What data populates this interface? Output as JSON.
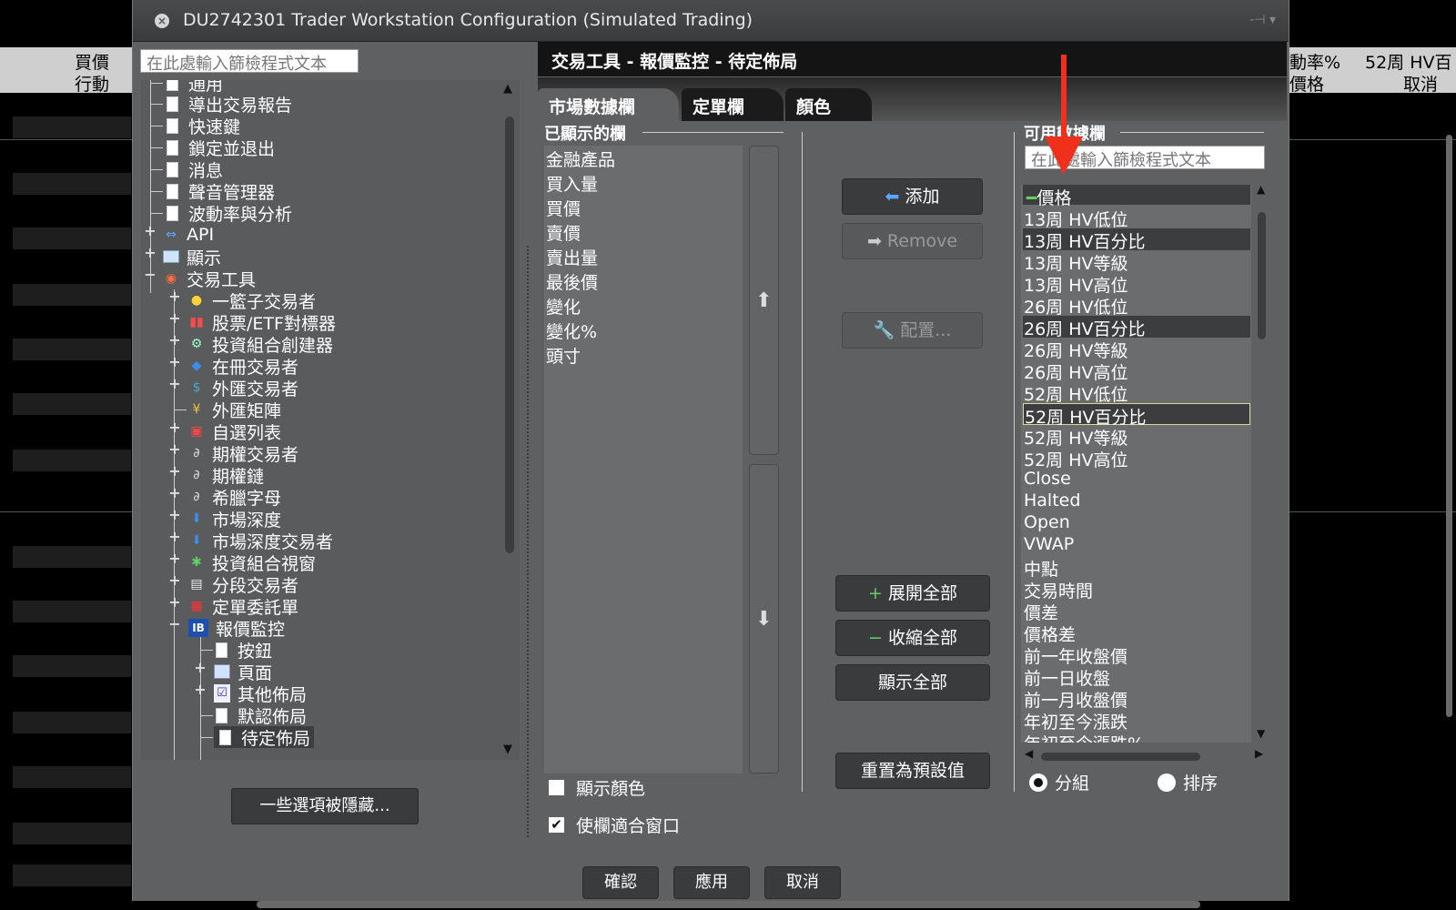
{
  "background": {
    "left_col_headers": [
      "買價",
      "行動"
    ],
    "right_col_headers": [
      "動率%",
      "52周 HV百",
      "價格",
      "取消"
    ]
  },
  "window": {
    "title": "DU2742301 Trader Workstation Configuration (Simulated Trading)",
    "close_glyph": "×",
    "pin_glyph": "-⊣ ▾"
  },
  "left": {
    "filter_placeholder": "在此處輸入篩檢程式文本",
    "tree": [
      {
        "label": "通用"
      },
      {
        "label": "導出交易報告"
      },
      {
        "label": "快速鍵"
      },
      {
        "label": "鎖定並退出"
      },
      {
        "label": "消息"
      },
      {
        "label": "聲音管理器"
      },
      {
        "label": "波動率與分析"
      },
      {
        "label": "API"
      },
      {
        "label": "顯示"
      },
      {
        "label": "交易工具"
      },
      {
        "label": "一籃子交易者"
      },
      {
        "label": "股票/ETF對標器"
      },
      {
        "label": "投資組合創建器"
      },
      {
        "label": "在冊交易者"
      },
      {
        "label": "外匯交易者"
      },
      {
        "label": "外匯矩陣"
      },
      {
        "label": "自選列表"
      },
      {
        "label": "期權交易者"
      },
      {
        "label": "期權鏈"
      },
      {
        "label": "希臘字母"
      },
      {
        "label": "市場深度"
      },
      {
        "label": "市場深度交易者"
      },
      {
        "label": "投資組合視窗"
      },
      {
        "label": "分段交易者"
      },
      {
        "label": "定單委託單"
      },
      {
        "label": "報價監控"
      },
      {
        "label": "按鈕"
      },
      {
        "label": "頁面"
      },
      {
        "label": "其他佈局"
      },
      {
        "label": "默認佈局"
      },
      {
        "label": "待定佈局"
      }
    ],
    "hidden_options_button": "一些選項被隱藏..."
  },
  "right": {
    "section_title": "交易工具 - 報價監控 - 待定佈局",
    "tabs": [
      "市場數據欄",
      "定單欄",
      "顏色"
    ],
    "shown_columns_label": "已顯示的欄",
    "shown_columns": [
      "金融產品",
      "買入量",
      "買價",
      "賣價",
      "賣出量",
      "最後價",
      "變化",
      "變化%",
      "頭寸"
    ],
    "buttons": {
      "add": "添加",
      "remove": "Remove",
      "configure": "配置...",
      "expand_all": "展開全部",
      "collapse_all": "收縮全部",
      "show_all": "顯示全部",
      "reset_default": "重置為預設值"
    },
    "available_label": "可用數據欄",
    "available_filter_placeholder": "在此處輸入篩檢程式文本",
    "available_group": "價格",
    "available_items": [
      "13周 HV低位",
      "13周 HV百分比",
      "13周 HV等級",
      "13周 HV高位",
      "26周 HV低位",
      "26周 HV百分比",
      "26周 HV等級",
      "26周 HV高位",
      "52周 HV低位",
      "52周 HV百分比",
      "52周 HV等級",
      "52周 HV高位",
      "Close",
      "Halted",
      "Open",
      "VWAP",
      "中點",
      "交易時間",
      "價差",
      "價格差",
      "前一年收盤價",
      "前一日收盤",
      "前一月收盤價",
      "年初至今漲跌",
      "年初至今漲跌%"
    ],
    "radio_group": "分組",
    "radio_sort": "排序",
    "show_colors": "顯示顏色",
    "fit_window": "使欄適合窗口"
  },
  "footer": {
    "ok": "確認",
    "apply": "應用",
    "cancel": "取消"
  }
}
